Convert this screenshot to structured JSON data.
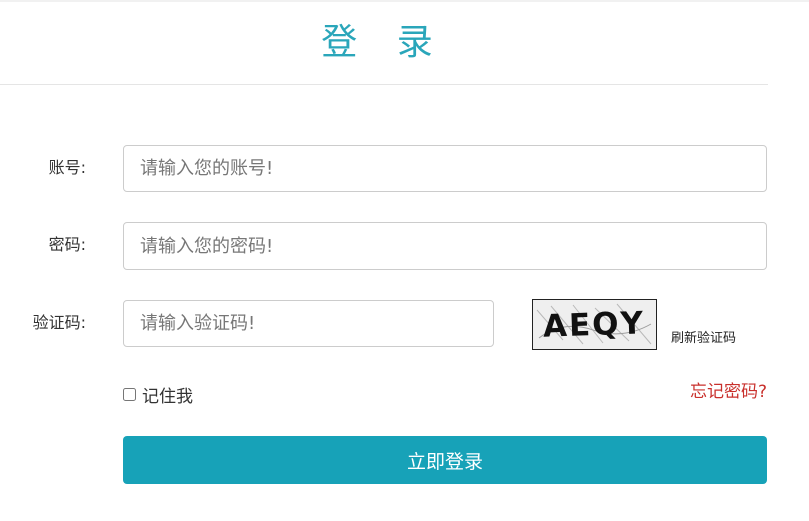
{
  "header": {
    "title": "登 录"
  },
  "form": {
    "account": {
      "label": "账号:",
      "placeholder": "请输入您的账号!"
    },
    "password": {
      "label": "密码:",
      "placeholder": "请输入您的密码!"
    },
    "captcha": {
      "label": "验证码:",
      "placeholder": "请输入验证码!",
      "image_text": "AEQY",
      "refresh_label": "刷新验证码"
    },
    "remember_label": "记住我",
    "forgot_label": "忘记密码?",
    "submit_label": "立即登录"
  },
  "colors": {
    "accent": "#17a2b8",
    "title": "#2aa6ba",
    "forgot": "#c9302c"
  }
}
